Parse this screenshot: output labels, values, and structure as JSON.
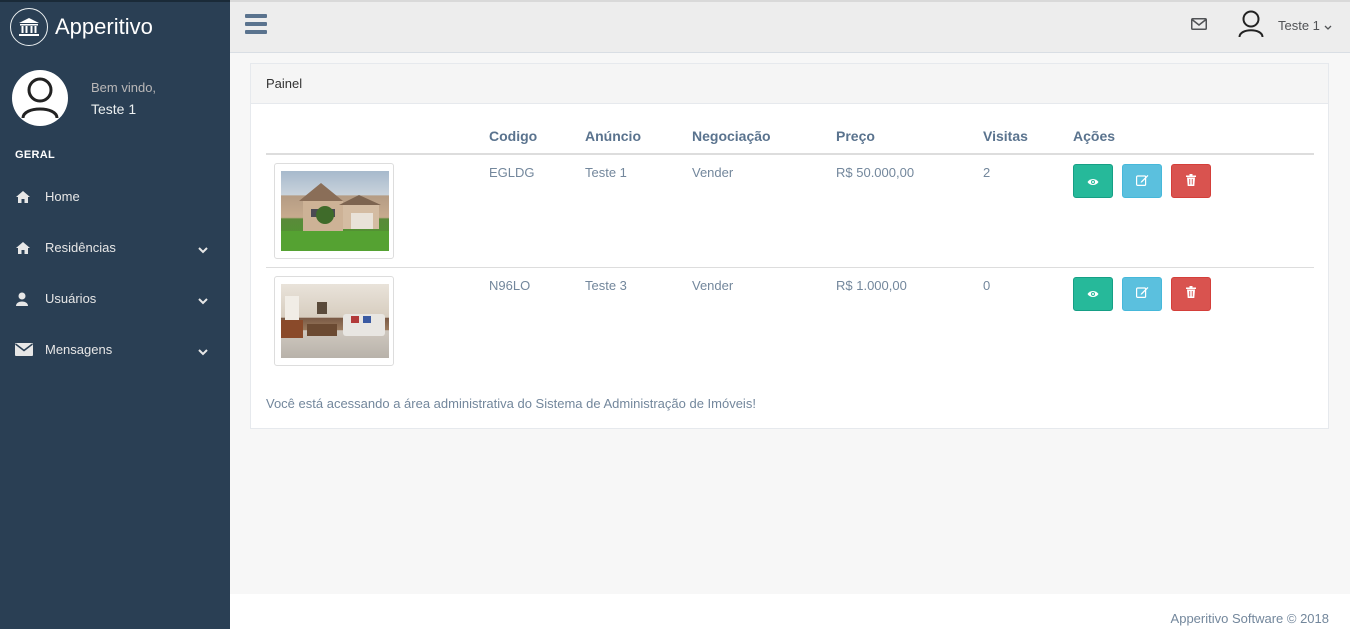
{
  "brand": {
    "name": "Apperitivo",
    "logo_icon": "bank-icon"
  },
  "profile": {
    "welcome": "Bem vindo,",
    "username": "Teste 1"
  },
  "sidebar": {
    "section_title": "GERAL",
    "items": [
      {
        "label": "Home",
        "icon": "home-icon",
        "has_submenu": false
      },
      {
        "label": "Residências",
        "icon": "home-icon",
        "has_submenu": true
      },
      {
        "label": "Usuários",
        "icon": "user-icon",
        "has_submenu": true
      },
      {
        "label": "Mensagens",
        "icon": "envelope-icon",
        "has_submenu": true
      }
    ]
  },
  "topnav": {
    "user_label": "Teste 1"
  },
  "panel": {
    "title": "Painel",
    "columns": [
      "",
      "Codigo",
      "Anúncio",
      "Negociação",
      "Preço",
      "Visitas",
      "Ações"
    ],
    "rows": [
      {
        "image": "house-exterior-photo",
        "codigo": "EGLDG",
        "anuncio": "Teste 1",
        "negociacao": "Vender",
        "preco": "R$ 50.000,00",
        "visitas": "2"
      },
      {
        "image": "living-room-photo",
        "codigo": "N96LO",
        "anuncio": "Teste 3",
        "negociacao": "Vender",
        "preco": "R$ 1.000,00",
        "visitas": "0"
      }
    ],
    "note": "Você está acessando a área administrativa do Sistema de Administração de Imóveis!"
  },
  "footer": {
    "text": "Apperitivo Software © 2018"
  },
  "colors": {
    "sidebar_bg": "#2a3f54",
    "view_button": "#26b99a",
    "edit_button": "#5bc0de",
    "delete_button": "#d9534f"
  }
}
